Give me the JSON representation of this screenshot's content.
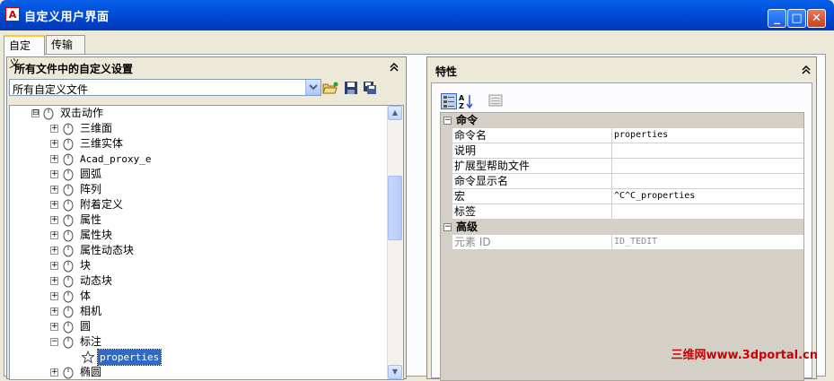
{
  "window": {
    "title": "自定义用户界面",
    "icon": "autocad-logo-icon"
  },
  "window_buttons": {
    "minimize": "_",
    "maximize": "□",
    "close": "✕"
  },
  "tabs": [
    {
      "label": "自定义",
      "active": true
    },
    {
      "label": "传输",
      "active": false
    }
  ],
  "left_panel": {
    "title": "所有文件中的自定义设置",
    "collapse_glyph": "⌃",
    "dropdown_value": "所有自定义文件",
    "toolbar": [
      "open-file-icon",
      "save-icon",
      "save-as-icon"
    ],
    "tree": [
      {
        "label": "双击动作",
        "expander": "⊟",
        "level": 0
      },
      {
        "label": "三维面",
        "expander": "+",
        "level": 1
      },
      {
        "label": "三维实体",
        "expander": "+",
        "level": 1
      },
      {
        "label": "Acad_proxy_e",
        "expander": "+",
        "level": 1
      },
      {
        "label": "圆弧",
        "expander": "+",
        "level": 1
      },
      {
        "label": "阵列",
        "expander": "+",
        "level": 1
      },
      {
        "label": "附着定义",
        "expander": "+",
        "level": 1
      },
      {
        "label": "属性",
        "expander": "+",
        "level": 1
      },
      {
        "label": "属性块",
        "expander": "+",
        "level": 1
      },
      {
        "label": "属性动态块",
        "expander": "+",
        "level": 1
      },
      {
        "label": "块",
        "expander": "+",
        "level": 1
      },
      {
        "label": "动态块",
        "expander": "+",
        "level": 1
      },
      {
        "label": "体",
        "expander": "+",
        "level": 1
      },
      {
        "label": "相机",
        "expander": "+",
        "level": 1
      },
      {
        "label": "圆",
        "expander": "+",
        "level": 1
      },
      {
        "label": "标注",
        "expander": "−",
        "level": 1
      },
      {
        "label": "properties",
        "expander": "",
        "level": 2,
        "selected": true
      },
      {
        "label": "椭圆",
        "expander": "+",
        "level": 1
      }
    ],
    "scroll_up": "▲",
    "scroll_down": "▼"
  },
  "right_panel": {
    "title": "特性",
    "collapse_glyph": "⌃",
    "toolbar": [
      "categorized-icon",
      "alphabetical-sort-icon",
      "property-pages-icon"
    ],
    "categories": [
      {
        "label": "命令",
        "expander": "−",
        "properties": [
          {
            "name": "命令名",
            "value": "properties"
          },
          {
            "name": "说明",
            "value": ""
          },
          {
            "name": "扩展型帮助文件",
            "value": ""
          },
          {
            "name": "命令显示名",
            "value": ""
          },
          {
            "name": "宏",
            "value": "^C^C_properties"
          },
          {
            "name": "标签",
            "value": ""
          }
        ]
      },
      {
        "label": "高级",
        "expander": "−",
        "properties": [
          {
            "name": "元素 ID",
            "value": "ID_TEDIT",
            "readonly": true
          }
        ]
      }
    ]
  },
  "watermark": "三维网www.3dportal.cn",
  "colors": {
    "titlebar": "#0054e3",
    "selection": "#316ac5",
    "category_bg": "#d4d0c8",
    "watermark": "#cc0000"
  }
}
